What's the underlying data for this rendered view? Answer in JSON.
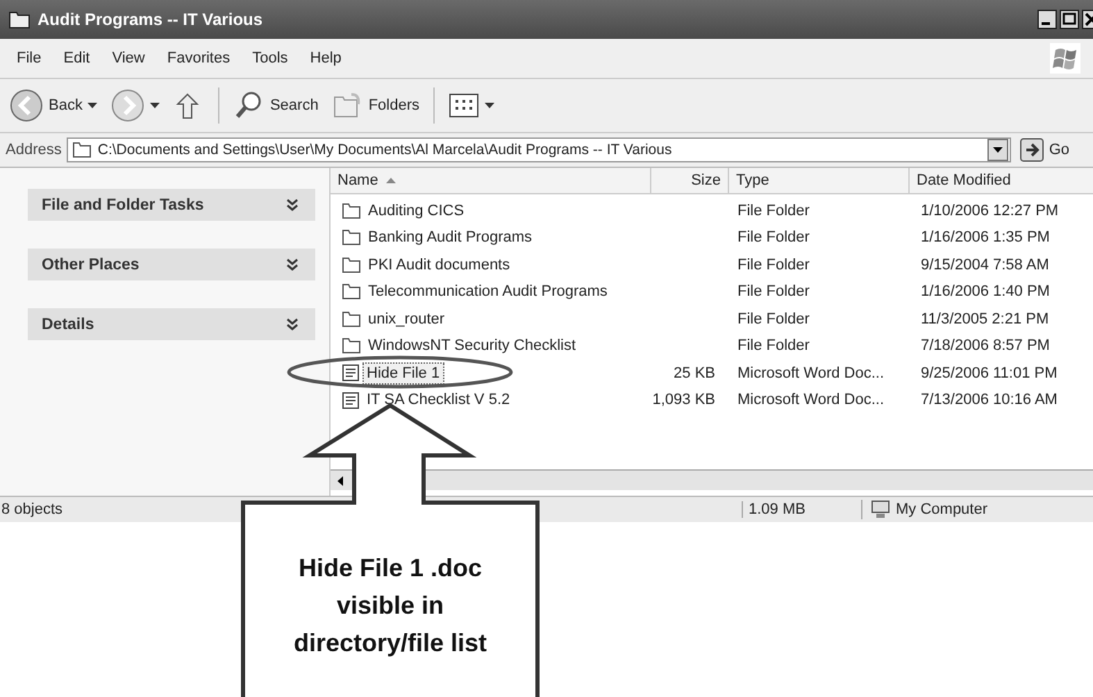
{
  "window": {
    "title": "Audit Programs -- IT Various"
  },
  "menu": [
    "File",
    "Edit",
    "View",
    "Favorites",
    "Tools",
    "Help"
  ],
  "toolbar": [
    {
      "kind": "back",
      "label": "Back"
    },
    {
      "kind": "forward"
    },
    {
      "kind": "up"
    },
    {
      "kind": "search",
      "label": "Search"
    },
    {
      "kind": "folders",
      "label": "Folders"
    },
    {
      "kind": "views"
    }
  ],
  "address": {
    "label": "Address",
    "value": "C:\\Documents and Settings\\User\\My Documents\\Al Marcela\\Audit Programs -- IT Various",
    "go": "Go"
  },
  "task_panels": [
    "File and Folder Tasks",
    "Other Places",
    "Details"
  ],
  "file_list": {
    "columns": [
      "Name",
      "Size",
      "Type",
      "Date Modified"
    ],
    "rows": [
      {
        "kind": "folder",
        "name": "Auditing CICS",
        "type": "File Folder",
        "date": "1/10/2006 12:27 PM",
        "selected": false
      },
      {
        "kind": "folder",
        "name": "Banking Audit Programs",
        "type": "File Folder",
        "date": "1/16/2006 1:35 PM",
        "selected": false
      },
      {
        "kind": "folder",
        "name": "PKI Audit documents",
        "type": "File Folder",
        "date": "9/15/2004 7:58 AM",
        "selected": false
      },
      {
        "kind": "folder",
        "name": "Telecommunication Audit Programs",
        "type": "File Folder",
        "date": "1/16/2006 1:40 PM",
        "selected": false
      },
      {
        "kind": "folder",
        "name": "unix_router",
        "type": "File Folder",
        "date": "11/3/2005 2:21 PM",
        "selected": false
      },
      {
        "kind": "folder",
        "name": "WindowsNT Security Checklist",
        "type": "File Folder",
        "date": "7/18/2006 8:57 PM",
        "selected": false
      },
      {
        "kind": "document",
        "name": "Hide File 1",
        "size": "25 KB",
        "type": "Microsoft Word Doc...",
        "date": "9/25/2006 11:01 PM",
        "selected": true
      },
      {
        "kind": "document",
        "name": "IT SA Checklist V 5.2",
        "size": "1,093 KB",
        "type": "Microsoft Word Doc...",
        "date": "7/13/2006 10:16 AM",
        "selected": false
      }
    ]
  },
  "status_bar": {
    "objects": "8 objects",
    "size": "1.09 MB",
    "zone": "My Computer"
  },
  "callout": {
    "text": "Hide File 1 .doc visible in directory/file list"
  }
}
